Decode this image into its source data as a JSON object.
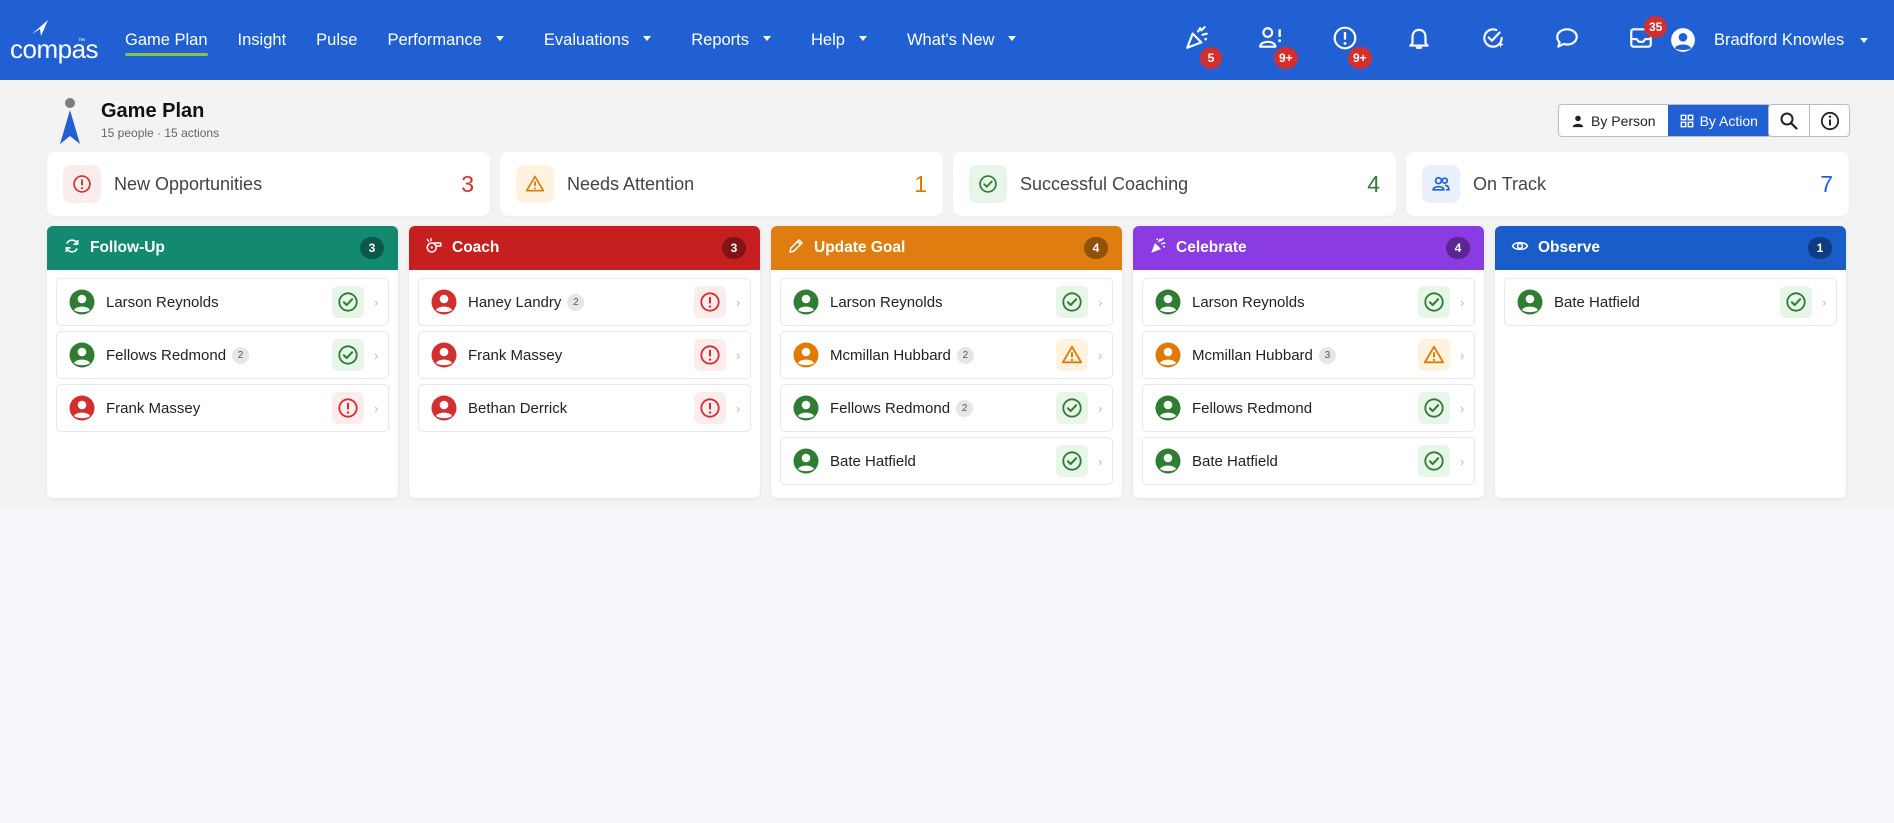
{
  "app": {
    "name": "compas",
    "trademark": "™"
  },
  "nav": {
    "items": [
      {
        "label": "Game Plan",
        "active": true,
        "dropdown": false
      },
      {
        "label": "Insight",
        "active": false,
        "dropdown": false
      },
      {
        "label": "Pulse",
        "active": false,
        "dropdown": false
      },
      {
        "label": "Performance",
        "active": false,
        "dropdown": true
      },
      {
        "label": "Evaluations",
        "active": false,
        "dropdown": true
      },
      {
        "label": "Reports",
        "active": false,
        "dropdown": true
      },
      {
        "label": "Help",
        "active": false,
        "dropdown": true
      },
      {
        "label": "What's New",
        "active": false,
        "dropdown": true
      }
    ],
    "icons": [
      {
        "name": "celebrate-icon",
        "badge": "5",
        "badge_pos": "bottom"
      },
      {
        "name": "person-alert-icon",
        "badge": "9+",
        "badge_pos": "bottom"
      },
      {
        "name": "alert-circle-icon",
        "badge": "9+",
        "badge_pos": "bottom"
      },
      {
        "name": "bell-icon",
        "badge": "",
        "badge_pos": ""
      },
      {
        "name": "check-star-icon",
        "badge": "",
        "badge_pos": ""
      },
      {
        "name": "chat-icon",
        "badge": "",
        "badge_pos": ""
      },
      {
        "name": "inbox-icon",
        "badge": "35",
        "badge_pos": "top"
      }
    ],
    "user_name": "Bradford Knowles"
  },
  "header": {
    "title": "Game Plan",
    "subtitle": "15 people · 15 actions",
    "view_by_person": "By Person",
    "view_by_action": "By Action",
    "active_view": "By Action"
  },
  "summary": [
    {
      "label": "New Opportunities",
      "count": "3",
      "color": "#d32f2f",
      "bg": "#fdecec",
      "icon": "alert-circle-icon"
    },
    {
      "label": "Needs Attention",
      "count": "1",
      "color": "#e07b00",
      "bg": "#fff3e0",
      "icon": "warning-icon"
    },
    {
      "label": "Successful Coaching",
      "count": "4",
      "color": "#2e7d32",
      "bg": "#e8f5e9",
      "icon": "check-circle-icon"
    },
    {
      "label": "On Track",
      "count": "7",
      "color": "#2160d3",
      "bg": "#e8f0fd",
      "icon": "people-icon"
    }
  ],
  "columns": [
    {
      "title": "Follow-Up",
      "count": "3",
      "color": "#13896f",
      "icon": "refresh-icon",
      "rows": [
        {
          "name": "Larson Reynolds",
          "count": "",
          "status": "success"
        },
        {
          "name": "Fellows Redmond",
          "count": "2",
          "status": "success"
        },
        {
          "name": "Frank Massey",
          "count": "",
          "status": "error"
        }
      ]
    },
    {
      "title": "Coach",
      "count": "3",
      "color": "#c51f1f",
      "icon": "whistle-icon",
      "rows": [
        {
          "name": "Haney Landry",
          "count": "2",
          "status": "error"
        },
        {
          "name": "Frank Massey",
          "count": "",
          "status": "error"
        },
        {
          "name": "Bethan Derrick",
          "count": "",
          "status": "error"
        }
      ]
    },
    {
      "title": "Update Goal",
      "count": "4",
      "color": "#e07d10",
      "icon": "pencil-icon",
      "rows": [
        {
          "name": "Larson Reynolds",
          "count": "",
          "status": "success"
        },
        {
          "name": "Mcmillan Hubbard",
          "count": "2",
          "status": "warning"
        },
        {
          "name": "Fellows Redmond",
          "count": "2",
          "status": "success"
        },
        {
          "name": "Bate Hatfield",
          "count": "",
          "status": "success"
        }
      ]
    },
    {
      "title": "Celebrate",
      "count": "4",
      "color": "#8b3be2",
      "icon": "party-icon",
      "rows": [
        {
          "name": "Larson Reynolds",
          "count": "",
          "status": "success"
        },
        {
          "name": "Mcmillan Hubbard",
          "count": "3",
          "status": "warning"
        },
        {
          "name": "Fellows Redmond",
          "count": "",
          "status": "success"
        },
        {
          "name": "Bate Hatfield",
          "count": "",
          "status": "success"
        }
      ]
    },
    {
      "title": "Observe",
      "count": "1",
      "color": "#1a5cc8",
      "icon": "eye-icon",
      "rows": [
        {
          "name": "Bate Hatfield",
          "count": "",
          "status": "success"
        }
      ]
    }
  ],
  "status_colors": {
    "success": "#2e7d32",
    "warning": "#e07b00",
    "error": "#d32f2f"
  }
}
